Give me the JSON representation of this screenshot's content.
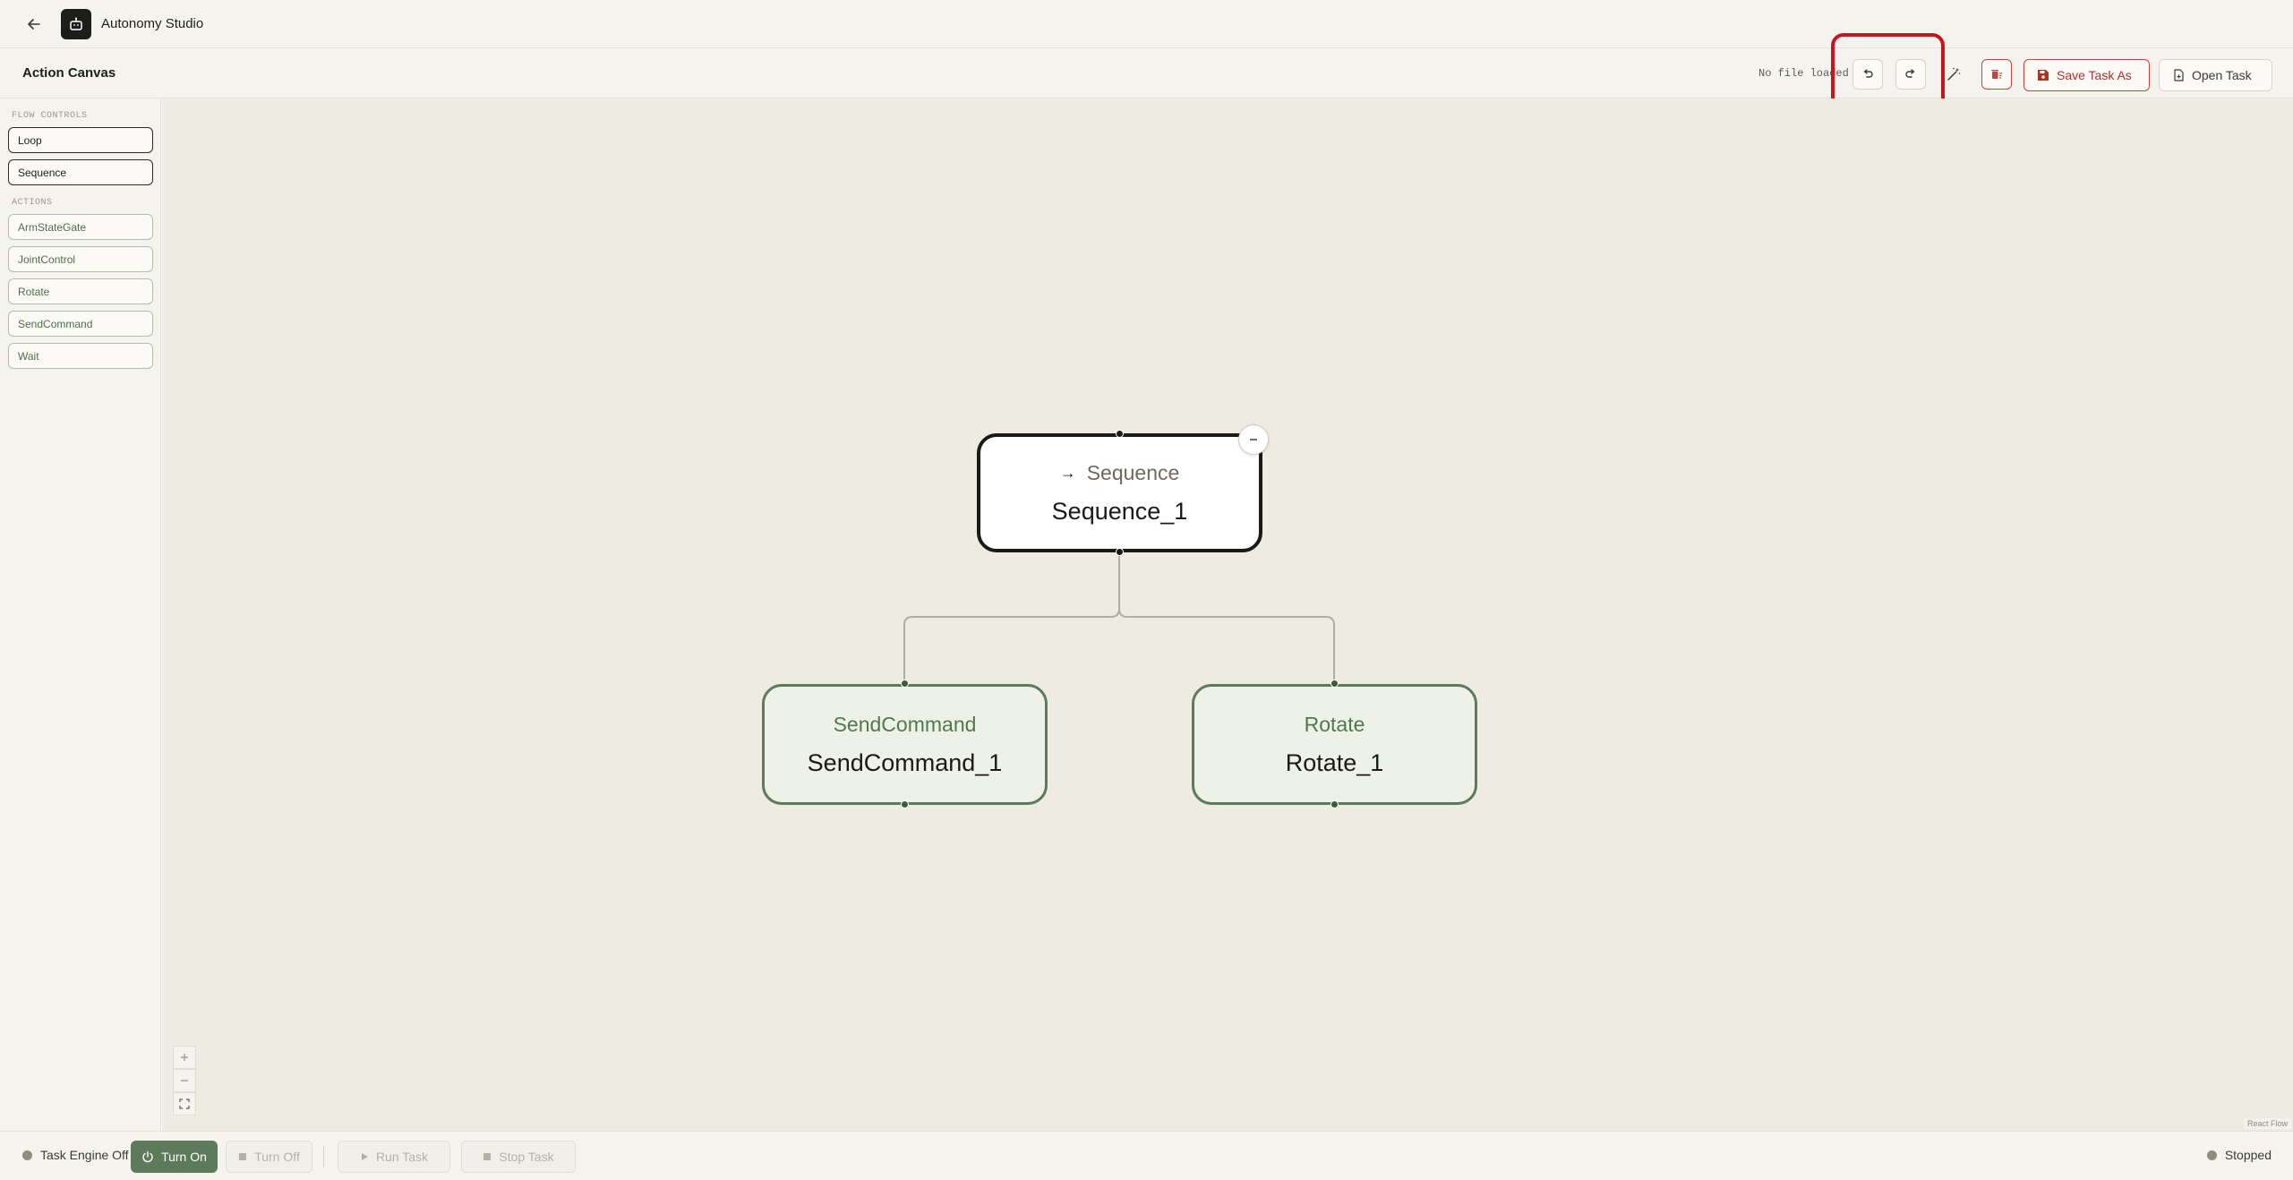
{
  "app": {
    "title": "Autonomy Studio"
  },
  "header": {
    "title": "Action Canvas",
    "file_status": "No file loaded",
    "save_label": "Save Task As",
    "open_label": "Open Task"
  },
  "sidebar": {
    "flow_section": "FLOW CONTROLS",
    "flow_items": [
      "Loop",
      "Sequence"
    ],
    "actions_section": "ACTIONS",
    "action_items": [
      "ArmStateGate",
      "JointControl",
      "Rotate",
      "SendCommand",
      "Wait"
    ]
  },
  "canvas": {
    "nodes": [
      {
        "type_label": "Sequence",
        "name": "Sequence_1",
        "icon": "arrow-right-icon"
      },
      {
        "type_label": "SendCommand",
        "name": "SendCommand_1"
      },
      {
        "type_label": "Rotate",
        "name": "Rotate_1"
      }
    ],
    "attribution": "React Flow"
  },
  "footer": {
    "engine_status": "Task Engine Off",
    "turn_on": "Turn On",
    "turn_off": "Turn Off",
    "run_task": "Run Task",
    "stop_task": "Stop Task",
    "run_state": "Stopped"
  },
  "colors": {
    "accent_green": "#5d7a5a",
    "danger_red": "#c0473d",
    "highlight_red": "#c8141c",
    "canvas_bg": "#eeebe3"
  }
}
